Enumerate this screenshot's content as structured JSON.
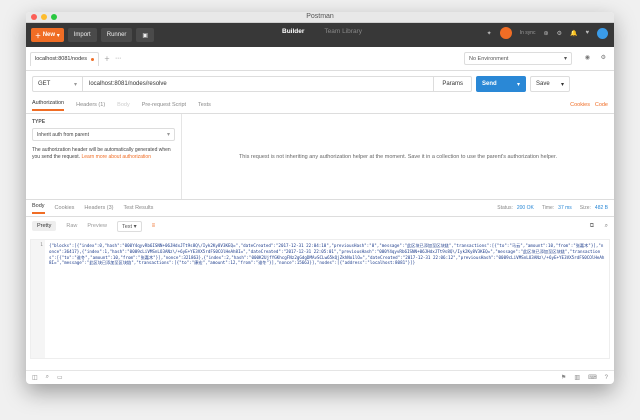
{
  "window": {
    "title": "Postman"
  },
  "toolbar": {
    "new_label": "New",
    "import_label": "Import",
    "runner_label": "Runner",
    "builder_label": "Builder",
    "team_label": "Team Library",
    "user_label": "In sync"
  },
  "tabs": [
    {
      "label": "localhost:8081/nodes"
    }
  ],
  "environment": {
    "label": "No Environment"
  },
  "request": {
    "method": "GET",
    "url": "localhost:8081/nodes/resolve",
    "params_label": "Params",
    "send_label": "Send",
    "save_label": "Save"
  },
  "subtabs": {
    "authorization": "Authorization",
    "headers": "Headers (1)",
    "body": "Body",
    "prerequest": "Pre-request Script",
    "tests": "Tests",
    "cookies": "Cookies",
    "code": "Code"
  },
  "auth": {
    "type_label": "TYPE",
    "type_value": "Inherit auth from parent",
    "note": "The authorization header will be automatically generated when you send the request.",
    "learn_more": "Learn more about authorization",
    "message": "This request is not inheriting any authorization helper at the moment. Save it in a collection to use the parent's authorization helper."
  },
  "response": {
    "body": "Body",
    "cookies": "Cookies",
    "headers": "Headers (3)",
    "tests": "Test Results",
    "status_label": "Status:",
    "status_value": "200 OK",
    "time_label": "Time:",
    "time_value": "37 ms",
    "size_label": "Size:",
    "size_value": "482 B"
  },
  "response_tools": {
    "pretty": "Pretty",
    "raw": "Raw",
    "preview": "Preview",
    "format": "Text"
  },
  "editor": {
    "line_number": "1",
    "content": "{\"blocks\":[{\"index\":0,\"hash\":\"000Y4qyvRb6ISNN+06JHdxJTt9s8Q\\/Iyk2Ky8V3KEQ=\",\"dateCreated\":\"2017-12-31 22:04:10\",\"previousHash\":\"0\",\"message\":\"此区块已添加至区块链\",\"transactions\":[{\"to\":\"马云\",\"amount\":10,\"from\":\"张嘉木\"}],\"nonce\":36417},{\"index\":1,\"hash\":\"0009cLiVMSnLO3ANz\\/+6yE+YE3VX5rdFS0COlHeAh8I=\",\"dateCreated\":\"2017-12-31 22:05:01\",\"previousHash\":\"000Y4qyvRb6ISNN+06JHdxJTt9s8Q\\/Iyk2Ky8V3KEQ=\",\"message\":\"此区块已添加至区块链\",\"transactions\":[{\"to\":\"谁冬\",\"amount\":10,\"from\":\"张嘉木\"}],\"nonce\":321863},{\"index\":2,\"hash\":\"000K2UjfYGKhcgFNz2gGdgDMAvSCLw65kQjZkhNo1lO=\",\"dateCreated\":\"2017-12-31 22:06:12\",\"previousHash\":\"0009cLiVMSnLO3ANz\\/+6yE+YE3VX5rdFS0COlHeAh8I=\",\"message\":\"此区块已添加至区块链\",\"transactions\":[{\"to\":\"康宏\",\"amount\":12,\"from\":\"谁冬\"}],\"nonce\":15663}],\"nodes\":[{\"address\":\"localhost:8081\"}]}"
  },
  "colors": {
    "accent": "#f06d25",
    "send": "#2a88d6",
    "toolbar": "#383838",
    "link": "#f06d25"
  }
}
